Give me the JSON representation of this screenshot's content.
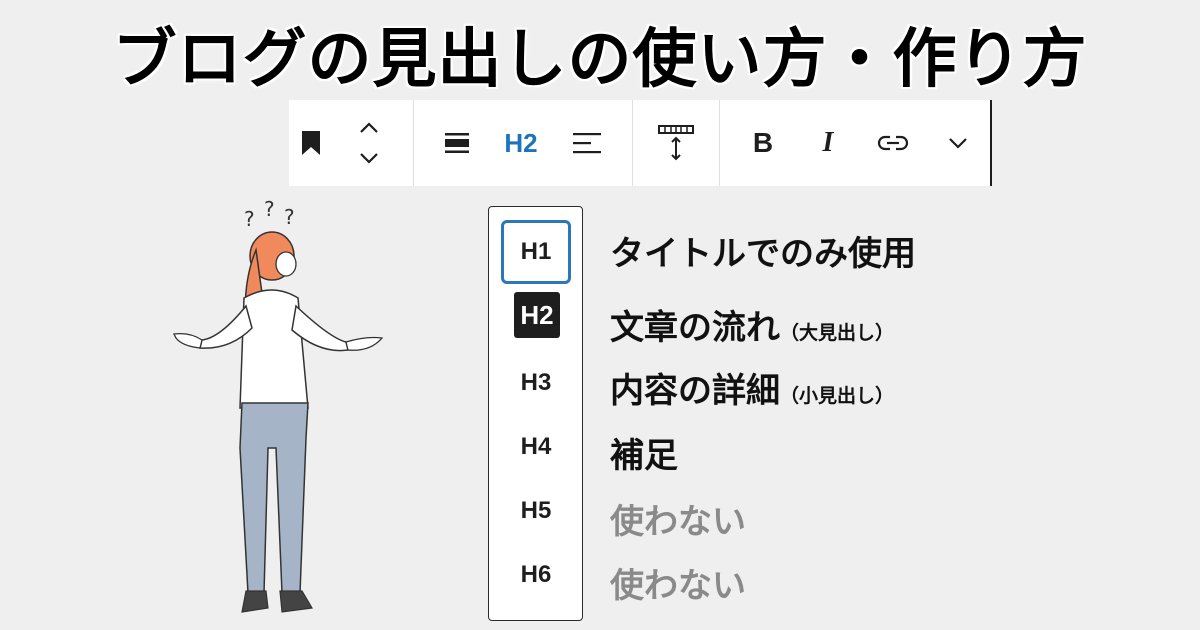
{
  "title": "ブログの見出しの使い方・作り方",
  "toolbar": {
    "bookmark_icon": "bookmark-icon",
    "move_up_icon": "chevron-up-icon",
    "move_down_icon": "chevron-down-icon",
    "align_icon": "align-wide-icon",
    "heading_level_label": "H2",
    "text_align_icon": "align-left-icon",
    "height_icon": "resize-height-icon",
    "bold_label": "B",
    "italic_label": "I",
    "link_icon": "link-icon",
    "more_icon": "chevron-down-icon",
    "accent_color": "#1e73be"
  },
  "levels": [
    {
      "label": "H1",
      "description": "タイトルでのみ使用",
      "sub": ""
    },
    {
      "label": "H2",
      "description": "文章の流れ",
      "sub": "（大見出し）"
    },
    {
      "label": "H3",
      "description": "内容の詳細",
      "sub": "（小見出し）"
    },
    {
      "label": "H4",
      "description": "補足",
      "sub": ""
    },
    {
      "label": "H5",
      "description": "使わない",
      "sub": ""
    },
    {
      "label": "H6",
      "description": "使わない",
      "sub": ""
    }
  ],
  "colors": {
    "background": "#efefef",
    "selected_outline": "#2b78b8",
    "active_fill": "#1e1e1e",
    "muted_text": "#8a8a8a"
  }
}
